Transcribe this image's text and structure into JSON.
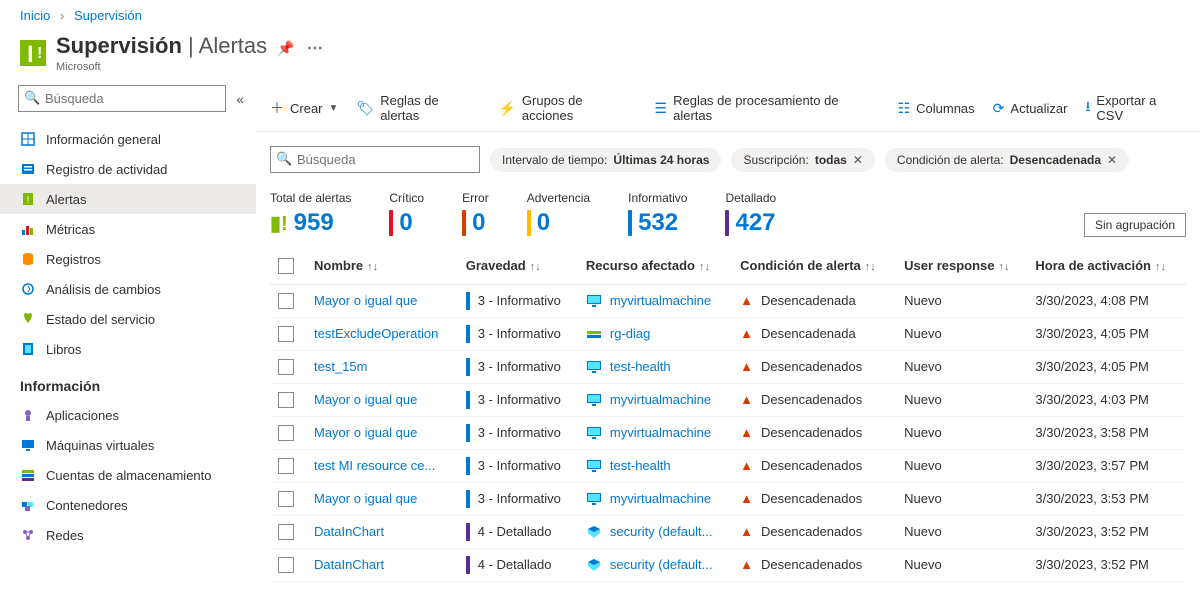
{
  "breadcrumb": {
    "home": "Inicio",
    "current": "Supervisión"
  },
  "header": {
    "title": "Supervisión",
    "subtitle": "Alertas",
    "org": "Microsoft"
  },
  "sidebar": {
    "search_placeholder": "Búsqueda",
    "items": [
      {
        "label": "Información general",
        "icon": "overview"
      },
      {
        "label": "Registro de actividad",
        "icon": "activity"
      },
      {
        "label": "Alertas",
        "icon": "alerts",
        "active": true
      },
      {
        "label": "Métricas",
        "icon": "metrics"
      },
      {
        "label": "Registros",
        "icon": "logs"
      },
      {
        "label": "Análisis de cambios",
        "icon": "changes"
      },
      {
        "label": "Estado del servicio",
        "icon": "health"
      },
      {
        "label": "Libros",
        "icon": "workbooks"
      }
    ],
    "group_label": "Información",
    "group_items": [
      {
        "label": "Aplicaciones",
        "icon": "apps"
      },
      {
        "label": "Máquinas virtuales",
        "icon": "vms"
      },
      {
        "label": "Cuentas de almacenamiento",
        "icon": "storage"
      },
      {
        "label": "Contenedores",
        "icon": "containers"
      },
      {
        "label": "Redes",
        "icon": "networks"
      }
    ]
  },
  "toolbar": {
    "create": "Crear",
    "alert_rules": "Reglas de alertas",
    "action_groups": "Grupos de acciones",
    "processing_rules": "Reglas de procesamiento de alertas",
    "columns": "Columnas",
    "refresh": "Actualizar",
    "export": "Exportar a CSV"
  },
  "filters": {
    "search_placeholder": "Búsqueda",
    "time_label": "Intervalo de tiempo: ",
    "time_value": "Últimas 24 horas",
    "sub_label": "Suscripción: ",
    "sub_value": "todas",
    "cond_label": "Condición de alerta: ",
    "cond_value": "Desencadenada"
  },
  "summary": {
    "total_label": "Total de alertas",
    "total_value": "959",
    "critical_label": "Crítico",
    "critical_value": "0",
    "error_label": "Error",
    "error_value": "0",
    "warning_label": "Advertencia",
    "warning_value": "0",
    "info_label": "Informativo",
    "info_value": "532",
    "verbose_label": "Detallado",
    "verbose_value": "427",
    "group_select": "Sin agrupación"
  },
  "columns": {
    "name": "Nombre",
    "severity": "Gravedad",
    "resource": "Recurso afectado",
    "condition": "Condición de alerta",
    "response": "User response",
    "time": "Hora de activación"
  },
  "rows": [
    {
      "name": "Mayor o igual que",
      "sev": "3 - Informativo",
      "sevcolor": "#0078d4",
      "res": "myvirtualmachine",
      "restype": "vm",
      "cond": "Desencadenada",
      "resp": "Nuevo",
      "time": "3/30/2023, 4:08 PM"
    },
    {
      "name": "testExcludeOperation",
      "sev": "3 - Informativo",
      "sevcolor": "#0078d4",
      "res": "rg-diag",
      "restype": "rg",
      "cond": "Desencadenada",
      "resp": "Nuevo",
      "time": "3/30/2023, 4:05 PM"
    },
    {
      "name": "test_15m",
      "sev": "3 - Informativo",
      "sevcolor": "#0078d4",
      "res": "test-health",
      "restype": "vm",
      "cond": "Desencadenados",
      "resp": "Nuevo",
      "time": "3/30/2023, 4:05 PM"
    },
    {
      "name": "Mayor o igual que",
      "sev": "3 - Informativo",
      "sevcolor": "#0078d4",
      "res": "myvirtualmachine",
      "restype": "vm",
      "cond": "Desencadenados",
      "resp": "Nuevo",
      "time": "3/30/2023, 4:03 PM"
    },
    {
      "name": "Mayor o igual que",
      "sev": "3 - Informativo",
      "sevcolor": "#0078d4",
      "res": "myvirtualmachine",
      "restype": "vm",
      "cond": "Desencadenados",
      "resp": "Nuevo",
      "time": "3/30/2023, 3:58 PM"
    },
    {
      "name": "test MI resource ce...",
      "sev": "3 - Informativo",
      "sevcolor": "#0078d4",
      "res": "test-health",
      "restype": "vm",
      "cond": "Desencadenados",
      "resp": "Nuevo",
      "time": "3/30/2023, 3:57 PM"
    },
    {
      "name": "Mayor o igual que",
      "sev": "3 - Informativo",
      "sevcolor": "#0078d4",
      "res": "myvirtualmachine",
      "restype": "vm",
      "cond": "Desencadenados",
      "resp": "Nuevo",
      "time": "3/30/2023, 3:53 PM"
    },
    {
      "name": "DataInChart",
      "sev": "4 - Detallado",
      "sevcolor": "#5c2d91",
      "res": "security (default...",
      "restype": "sec",
      "cond": "Desencadenados",
      "resp": "Nuevo",
      "time": "3/30/2023, 3:52 PM"
    },
    {
      "name": "DataInChart",
      "sev": "4 - Detallado",
      "sevcolor": "#5c2d91",
      "res": "security (default...",
      "restype": "sec",
      "cond": "Desencadenados",
      "resp": "Nuevo",
      "time": "3/30/2023, 3:52 PM"
    }
  ]
}
